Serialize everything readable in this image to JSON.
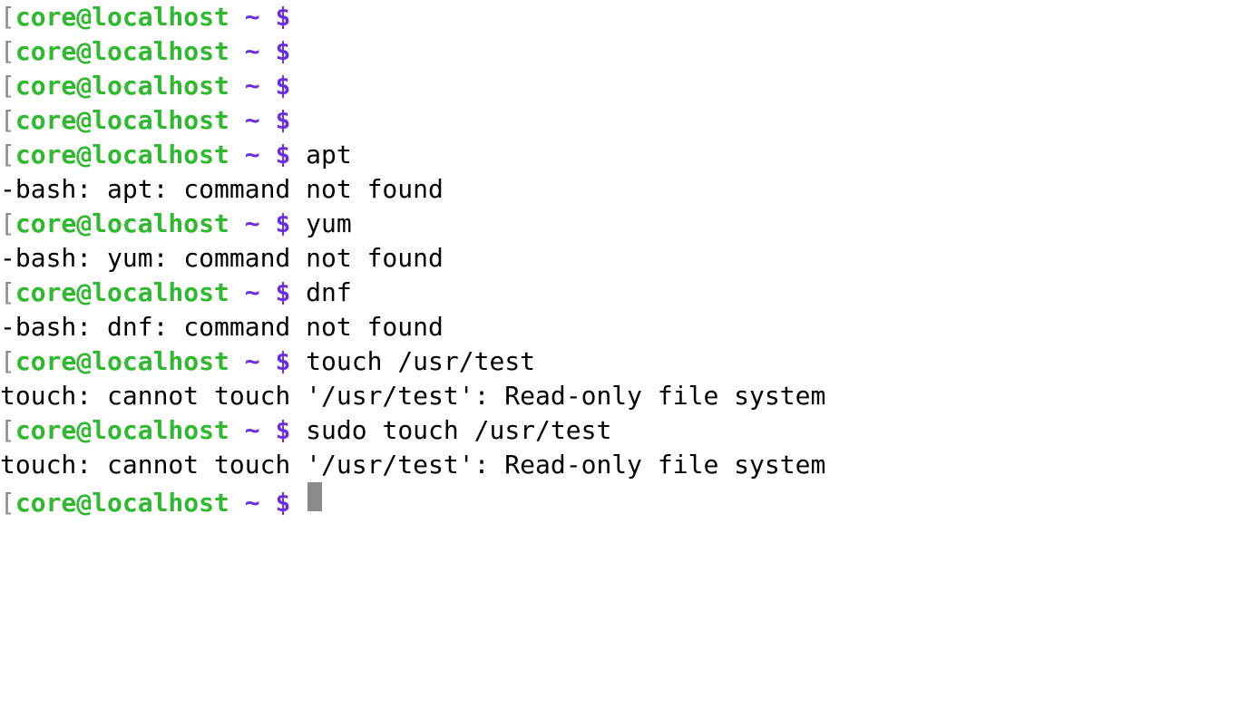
{
  "prompt": {
    "bracket": "[",
    "user_host": "core@localhost",
    "tilde": "~",
    "dollar": "$"
  },
  "lines": [
    {
      "type": "prompt",
      "cmd": ""
    },
    {
      "type": "prompt",
      "cmd": ""
    },
    {
      "type": "prompt",
      "cmd": ""
    },
    {
      "type": "prompt",
      "cmd": ""
    },
    {
      "type": "prompt",
      "cmd": "apt"
    },
    {
      "type": "output",
      "text": "-bash: apt: command not found"
    },
    {
      "type": "prompt",
      "cmd": "yum"
    },
    {
      "type": "output",
      "text": "-bash: yum: command not found"
    },
    {
      "type": "prompt",
      "cmd": "dnf"
    },
    {
      "type": "output",
      "text": "-bash: dnf: command not found"
    },
    {
      "type": "prompt",
      "cmd": "touch /usr/test"
    },
    {
      "type": "output",
      "text": "touch: cannot touch '/usr/test': Read-only file system"
    },
    {
      "type": "prompt",
      "cmd": "sudo touch /usr/test"
    },
    {
      "type": "output",
      "text": "touch: cannot touch '/usr/test': Read-only file system"
    },
    {
      "type": "prompt-cursor",
      "cmd": ""
    }
  ]
}
